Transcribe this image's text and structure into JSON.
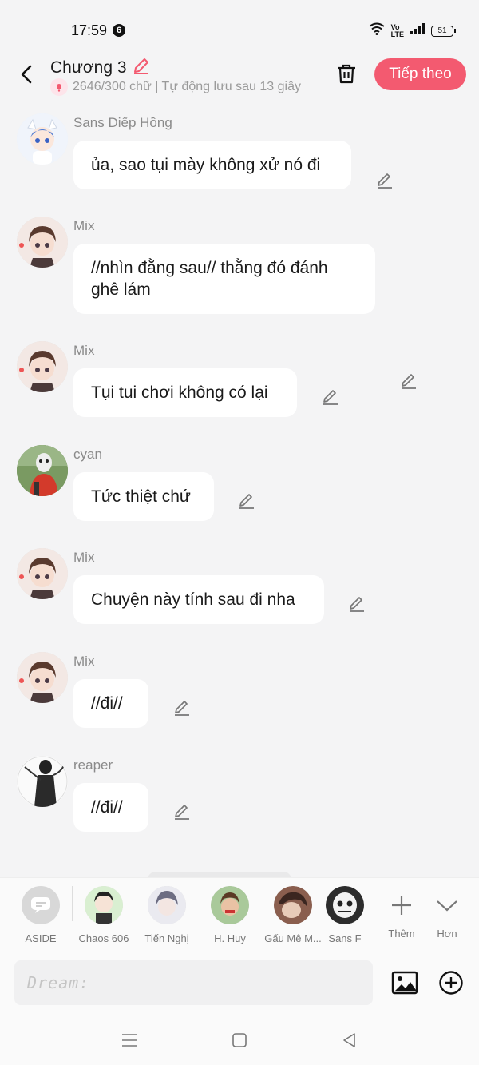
{
  "status": {
    "time": "17:59",
    "notif_count": "6",
    "lte": "Vo\nLTE",
    "battery": "51"
  },
  "header": {
    "title": "Chương 3",
    "subtitle": "2646/300 chữ | Tự động lưu sau 13 giây",
    "next_label": "Tiếp theo"
  },
  "messages": [
    {
      "sender": "Sans Diếp Hồng",
      "text": "ủa, sao tụi mày không xử nó đi"
    },
    {
      "sender": "Mix",
      "text": "//nhìn đằng sau// thằng đó đánh ghê lám"
    },
    {
      "sender": "Mix",
      "text": "Tụi tui chơi không có lại"
    },
    {
      "sender": "cyan",
      "text": "Tức thiệt chứ"
    },
    {
      "sender": "Mix",
      "text": "Chuyện này tính sau đi nha"
    },
    {
      "sender": "Mix",
      "text": "//đi//"
    },
    {
      "sender": "reaper",
      "text": "//đi//"
    }
  ],
  "characters": [
    {
      "name": "ASIDE"
    },
    {
      "name": "Chaos 606"
    },
    {
      "name": "Tiến Nghị"
    },
    {
      "name": "H. Huy"
    },
    {
      "name": "Gấu Mê M..."
    },
    {
      "name": "Sans F"
    }
  ],
  "more_label": "Thêm",
  "collapse_label": "Hơn",
  "input": {
    "placeholder": "Dream:"
  },
  "colors": {
    "accent": "#f35a70",
    "background": "#f4f4f5",
    "bubble": "#ffffff"
  }
}
